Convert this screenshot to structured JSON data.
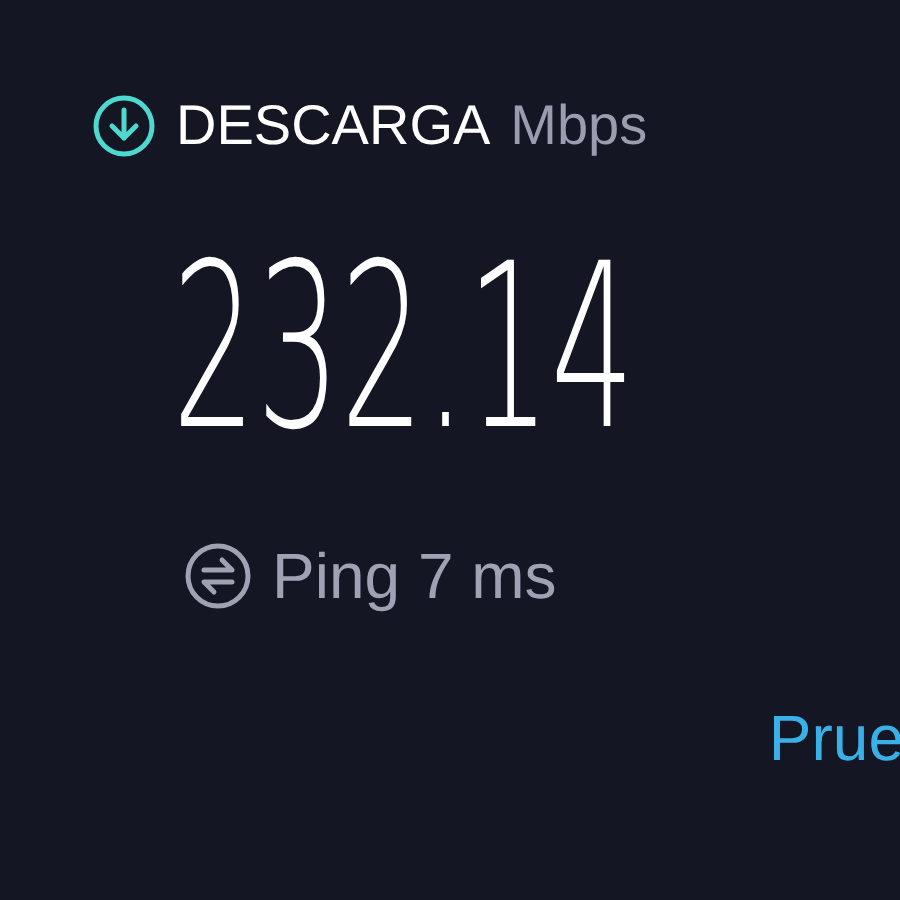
{
  "download": {
    "label": "DESCARGA",
    "unit": "Mbps",
    "value": "232.14"
  },
  "ping": {
    "label": "Ping 7 ms"
  },
  "link": {
    "label": "Prue"
  }
}
